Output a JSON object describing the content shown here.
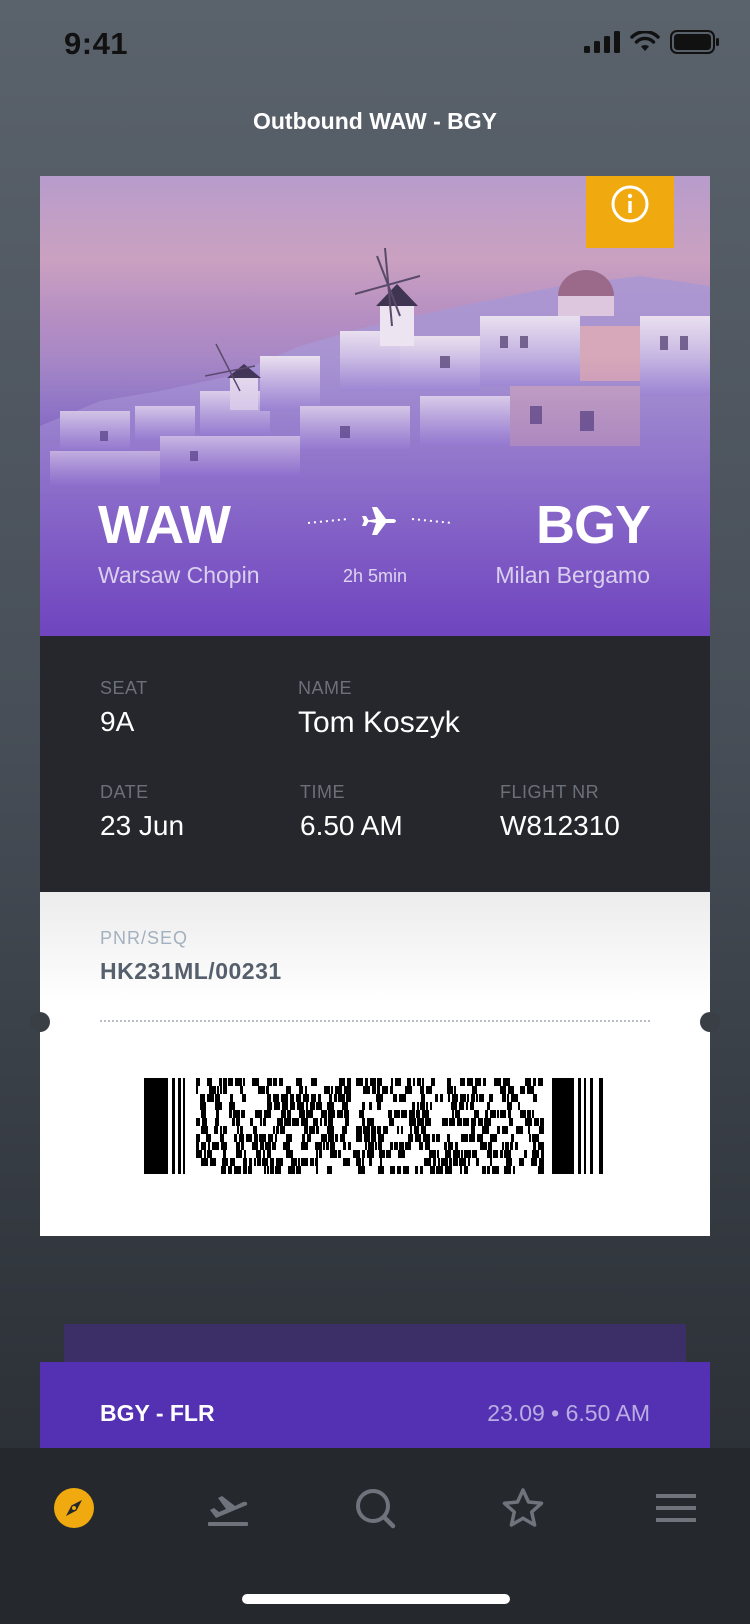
{
  "status_bar": {
    "time": "9:41"
  },
  "header": {
    "title": "Outbound WAW - BGY"
  },
  "flight": {
    "origin_code": "WAW",
    "origin_name": "Warsaw Chopin",
    "destination_code": "BGY",
    "destination_name": "Milan Bergamo",
    "duration": "2h 5min"
  },
  "details": {
    "seat_label": "SEAT",
    "seat_value": "9A",
    "name_label": "NAME",
    "name_value": "Tom Koszyk",
    "date_label": "DATE",
    "date_value": "23 Jun",
    "time_label": "TIME",
    "time_value": "6.50 AM",
    "flight_label": "FLIGHT NR",
    "flight_value": "W812310"
  },
  "boarding": {
    "pnr_label": "PNR/SEQ",
    "pnr_value": "HK231ML/00231"
  },
  "next_flight": {
    "route": "BGY - FLR",
    "datetime": "23.09 • 6.50 AM"
  },
  "tab_bar": {
    "items": [
      "explore-icon",
      "departures-icon",
      "search-icon",
      "favorites-icon",
      "menu-icon"
    ],
    "active_color": "#f0a90e",
    "inactive_color": "#6e737c"
  },
  "colors": {
    "accent": "#f0a90e",
    "purple": "#5430b3",
    "card_dark": "#25272c"
  }
}
